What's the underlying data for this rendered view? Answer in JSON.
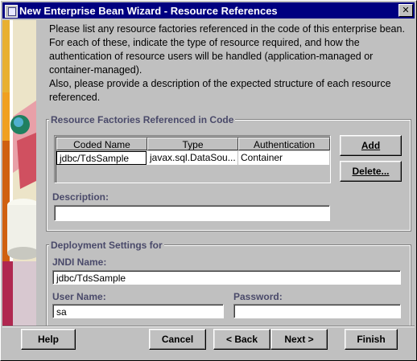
{
  "window": {
    "title": "New Enterprise Bean Wizard - Resource References",
    "close_glyph": "✕"
  },
  "intro": {
    "lines": [
      "Please list any resource factories referenced in the code of this enterprise bean.",
      "For each of these, indicate the type of resource required, and how the",
      "authentication of resource users will be handled (application-managed or",
      "container-managed).",
      "Also, please provide a description of the expected structure of each resource",
      "referenced."
    ]
  },
  "resource_factories": {
    "title": "Resource Factories Referenced in Code",
    "columns": [
      "Coded Name",
      "Type",
      "Authentication"
    ],
    "rows": [
      {
        "coded_name": "jdbc/TdsSample",
        "type": "javax.sql.DataSou...",
        "authentication": "Container"
      }
    ],
    "add_label": "Add",
    "delete_label": "Delete...",
    "description_label": "Description:",
    "description_value": ""
  },
  "deployment": {
    "title": "Deployment Settings for",
    "jndi_label": "JNDI Name:",
    "jndi_value": "jdbc/TdsSample",
    "user_label": "User Name:",
    "user_value": "sa",
    "password_label": "Password:",
    "password_value": ""
  },
  "footer": {
    "help": "Help",
    "cancel": "Cancel",
    "back": "< Back",
    "next": "Next >",
    "finish": "Finish"
  },
  "colors": {
    "title_bar": "#000080",
    "group_label": "#4a4a6a",
    "background": "#c0c0c0"
  },
  "icons": [
    "window-app-icon",
    "close-icon",
    "wizard-banner-image"
  ]
}
